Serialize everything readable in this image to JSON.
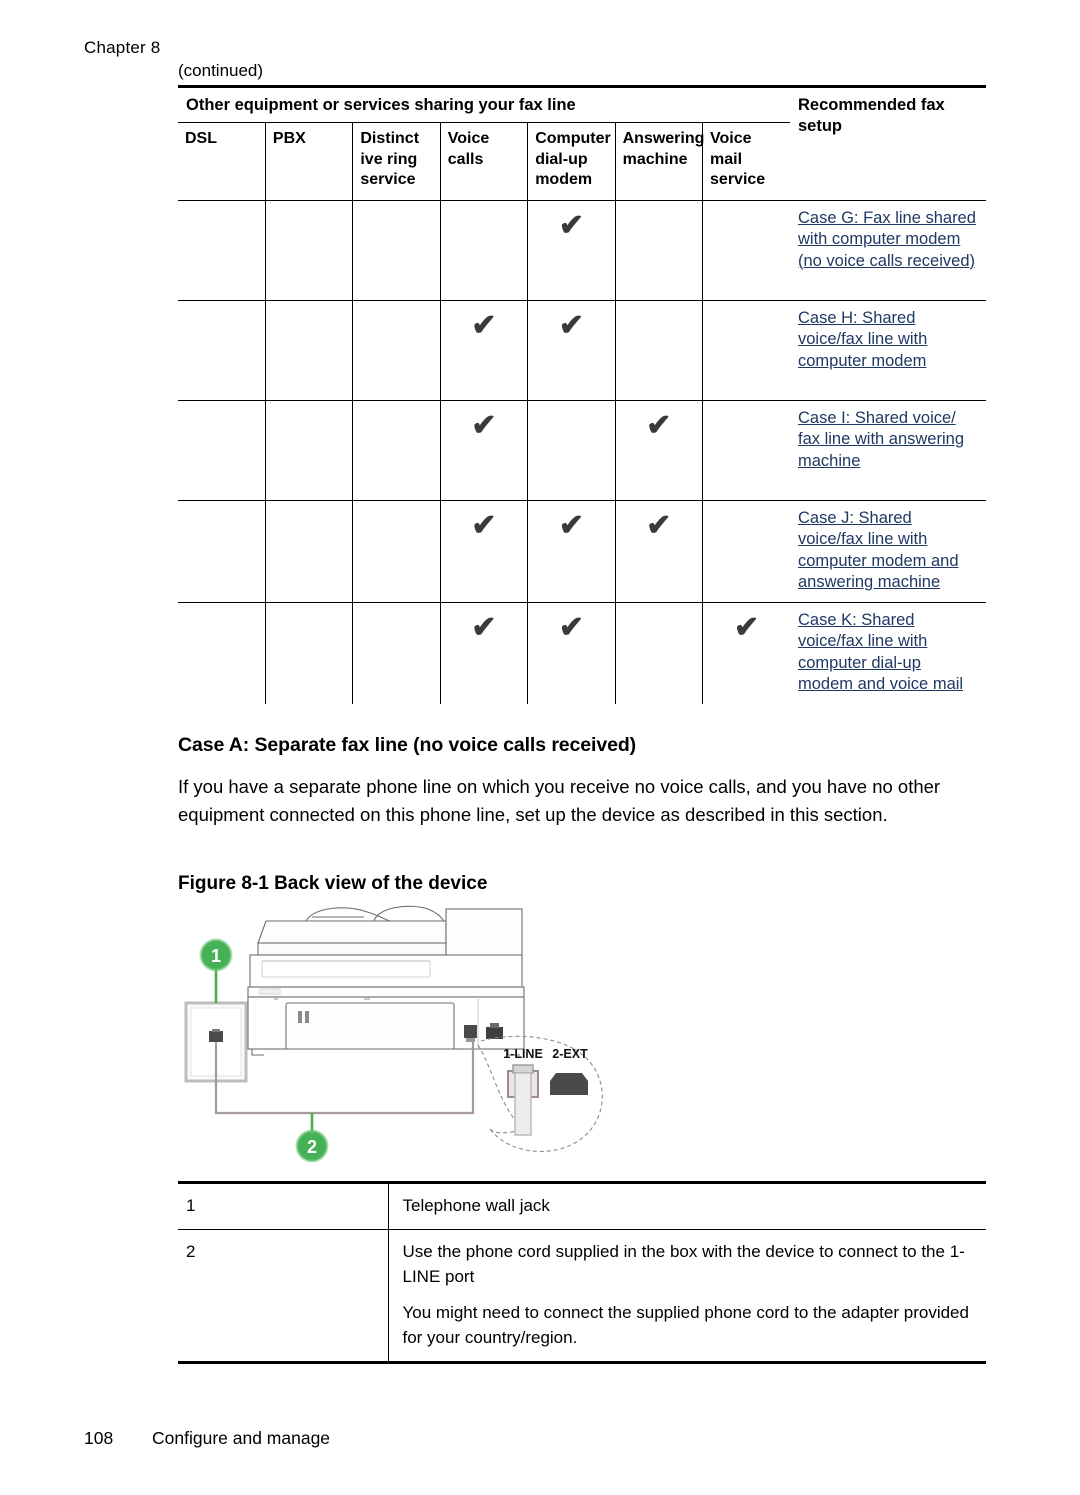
{
  "running_head": {
    "chapter": "Chapter 8"
  },
  "table_continued_label": "(continued)",
  "fax_table": {
    "span_header": "Other equipment or services sharing your fax line",
    "recommended_header": "Recommended fax setup",
    "columns": [
      "DSL",
      "PBX",
      "Distinct ive ring service",
      "Voice calls",
      "Computer dial-up modem",
      "Answering machine",
      "Voice mail service"
    ],
    "check_glyph": "✔",
    "link_color": "#1f3864",
    "rows": [
      {
        "checks": [
          false,
          false,
          false,
          false,
          true,
          false,
          false
        ],
        "recommended": "Case G: Fax line shared with computer modem (no voice calls received)"
      },
      {
        "checks": [
          false,
          false,
          false,
          true,
          true,
          false,
          false
        ],
        "recommended": "Case H: Shared voice/fax line with computer modem"
      },
      {
        "checks": [
          false,
          false,
          false,
          true,
          false,
          true,
          false
        ],
        "recommended": "Case I: Shared voice/ fax line with answering machine"
      },
      {
        "checks": [
          false,
          false,
          false,
          true,
          true,
          true,
          false
        ],
        "recommended": "Case J: Shared voice/fax line with computer modem and answering machine"
      },
      {
        "checks": [
          false,
          false,
          false,
          true,
          true,
          false,
          true
        ],
        "recommended": "Case K: Shared voice/fax line with computer dial-up modem and voice mail"
      }
    ]
  },
  "section": {
    "title": "Case A: Separate fax line (no voice calls received)",
    "paragraph": "If you have a separate phone line on which you receive no voice calls, and you have no other equipment connected on this phone line, set up the device as described in this section."
  },
  "figure": {
    "title": "Figure 8-1 Back view of the device",
    "callout_1": "1",
    "callout_2": "2",
    "port_line_label": "1-LINE",
    "port_ext_label": "2-EXT",
    "marker_color": "#4caf50"
  },
  "legend_table": {
    "rows": [
      {
        "num": "1",
        "lines": [
          "Telephone wall jack"
        ]
      },
      {
        "num": "2",
        "lines": [
          "Use the phone cord supplied in the box with the device to connect to the 1-LINE port",
          "You might need to connect the supplied phone cord to the adapter provided for your country/region."
        ]
      }
    ]
  },
  "footer": {
    "page_number": "108",
    "section_label": "Configure and manage"
  }
}
